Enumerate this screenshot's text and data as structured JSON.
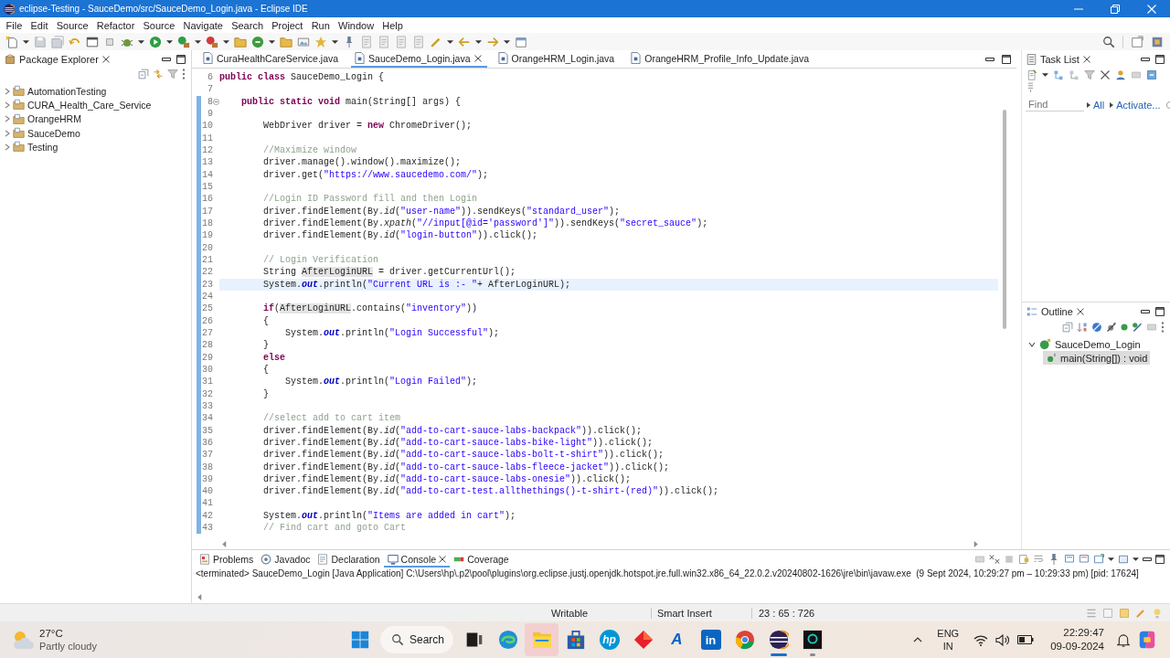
{
  "window": {
    "title": "eclipse-Testing - SauceDemo/src/SauceDemo_Login.java - Eclipse IDE"
  },
  "menu": [
    "File",
    "Edit",
    "Source",
    "Refactor",
    "Source",
    "Navigate",
    "Search",
    "Project",
    "Run",
    "Window",
    "Help"
  ],
  "package_explorer": {
    "title": "Package Explorer",
    "projects": [
      {
        "name": "AutomationTesting",
        "expanded": false
      },
      {
        "name": "CURA_Health_Care_Service",
        "expanded": false
      },
      {
        "name": "OrangeHRM",
        "expanded": false
      },
      {
        "name": "SauceDemo",
        "expanded": false
      },
      {
        "name": "Testing",
        "expanded": false
      }
    ]
  },
  "editor": {
    "tabs": [
      {
        "label": "CuraHealthCareService.java",
        "selected": false
      },
      {
        "label": "SauceDemo_Login.java",
        "selected": true
      },
      {
        "label": "OrangeHRM_Login.java",
        "selected": false
      },
      {
        "label": "OrangeHRM_Profile_Info_Update.java",
        "selected": false
      }
    ],
    "blocks": [
      {
        "kind": "plain",
        "lines": [
          {
            "number": "6",
            "current": false,
            "tokens": [
              {
                "kind": "keyword",
                "text": "public class"
              },
              {
                "kind": "plain",
                "text": " SauceDemo_Login {"
              }
            ]
          },
          {
            "number": "7",
            "current": false
          }
        ]
      },
      {
        "kind": "range",
        "lines": [
          {
            "number": "8",
            "current": false,
            "expanded": true,
            "tokens": [
              {
                "kind": "keyword",
                "text": "    public static void"
              },
              {
                "kind": "plain",
                "text": " main(String[] args) {"
              }
            ]
          },
          {
            "number": "9",
            "current": false
          },
          {
            "number": "10",
            "current": false,
            "tokens": [
              {
                "kind": "plain",
                "text": "        WebDriver driver = "
              },
              {
                "kind": "keyword",
                "text": "new"
              },
              {
                "kind": "plain",
                "text": " ChromeDriver();"
              }
            ]
          },
          {
            "number": "11",
            "current": false
          },
          {
            "number": "12",
            "current": false,
            "tokens": [
              {
                "kind": "comment",
                "text": "        //Maximize window"
              }
            ]
          },
          {
            "number": "13",
            "current": false,
            "tokens": [
              {
                "kind": "plain",
                "text": "        driver.manage().window().maximize();"
              }
            ]
          },
          {
            "number": "14",
            "current": false,
            "tokens": [
              {
                "kind": "plain",
                "text": "        driver.get("
              },
              {
                "kind": "string",
                "text": "\"https://www.saucedemo.com/\""
              },
              {
                "kind": "plain",
                "text": ");"
              }
            ]
          },
          {
            "number": "15",
            "current": false
          },
          {
            "number": "16",
            "current": false,
            "tokens": [
              {
                "kind": "comment",
                "text": "        //Login ID Password fill and then Login"
              }
            ]
          },
          {
            "number": "17",
            "current": false,
            "tokens": [
              {
                "kind": "plain",
                "text": "        driver.findElement(By."
              },
              {
                "kind": "static-method",
                "text": "id"
              },
              {
                "kind": "plain",
                "text": "("
              },
              {
                "kind": "string",
                "text": "\"user-name\""
              },
              {
                "kind": "plain",
                "text": ")).sendKeys("
              },
              {
                "kind": "string",
                "text": "\"standard_user\""
              },
              {
                "kind": "plain",
                "text": ");"
              }
            ]
          },
          {
            "number": "18",
            "current": false,
            "tokens": [
              {
                "kind": "plain",
                "text": "        driver.findElement(By."
              },
              {
                "kind": "static-method",
                "text": "xpath"
              },
              {
                "kind": "plain",
                "text": "("
              },
              {
                "kind": "string",
                "text": "\"//input[@id='password']\""
              },
              {
                "kind": "plain",
                "text": ")).sendKeys("
              },
              {
                "kind": "string",
                "text": "\"secret_sauce\""
              },
              {
                "kind": "plain",
                "text": ");"
              }
            ]
          },
          {
            "number": "19",
            "current": false,
            "tokens": [
              {
                "kind": "plain",
                "text": "        driver.findElement(By."
              },
              {
                "kind": "static-method",
                "text": "id"
              },
              {
                "kind": "plain",
                "text": "("
              },
              {
                "kind": "string",
                "text": "\"login-button\""
              },
              {
                "kind": "plain",
                "text": ")).click();"
              }
            ]
          },
          {
            "number": "20",
            "current": false
          },
          {
            "number": "21",
            "current": false,
            "tokens": [
              {
                "kind": "comment",
                "text": "        // Login Verification"
              }
            ]
          },
          {
            "number": "22",
            "current": false,
            "tokens": [
              {
                "kind": "plain",
                "text": "        String "
              },
              {
                "kind": "occurrence",
                "text": "AfterLoginURL"
              },
              {
                "kind": "plain",
                "text": " = driver.getCurrentUrl();"
              }
            ]
          },
          {
            "number": "23",
            "current": true,
            "tokens": [
              {
                "kind": "plain",
                "text": "        System."
              },
              {
                "kind": "static-field",
                "text": "out"
              },
              {
                "kind": "plain",
                "text": ".println("
              },
              {
                "kind": "string",
                "text": "\"Current URL is :- \""
              },
              {
                "kind": "plain",
                "text": "+ AfterLoginURL);"
              }
            ]
          },
          {
            "number": "24",
            "current": false
          },
          {
            "number": "25",
            "current": false,
            "tokens": [
              {
                "kind": "keyword",
                "text": "        if"
              },
              {
                "kind": "plain",
                "text": "("
              },
              {
                "kind": "occurrence",
                "text": "AfterLoginURL"
              },
              {
                "kind": "plain",
                "text": ".contains("
              },
              {
                "kind": "string",
                "text": "\"inventory\""
              },
              {
                "kind": "plain",
                "text": "))"
              }
            ]
          },
          {
            "number": "26",
            "current": false,
            "tokens": [
              {
                "kind": "plain",
                "text": "        {"
              }
            ]
          },
          {
            "number": "27",
            "current": false,
            "tokens": [
              {
                "kind": "plain",
                "text": "            System."
              },
              {
                "kind": "static-field",
                "text": "out"
              },
              {
                "kind": "plain",
                "text": ".println("
              },
              {
                "kind": "string",
                "text": "\"Login Successful\""
              },
              {
                "kind": "plain",
                "text": ");"
              }
            ]
          },
          {
            "number": "28",
            "current": false,
            "tokens": [
              {
                "kind": "plain",
                "text": "        }"
              }
            ]
          },
          {
            "number": "29",
            "current": false,
            "tokens": [
              {
                "kind": "keyword",
                "text": "        else"
              }
            ]
          },
          {
            "number": "30",
            "current": false,
            "tokens": [
              {
                "kind": "plain",
                "text": "        {"
              }
            ]
          },
          {
            "number": "31",
            "current": false,
            "tokens": [
              {
                "kind": "plain",
                "text": "            System."
              },
              {
                "kind": "static-field",
                "text": "out"
              },
              {
                "kind": "plain",
                "text": ".println("
              },
              {
                "kind": "string",
                "text": "\"Login Failed\""
              },
              {
                "kind": "plain",
                "text": ");"
              }
            ]
          },
          {
            "number": "32",
            "current": false,
            "tokens": [
              {
                "kind": "plain",
                "text": "        }"
              }
            ]
          },
          {
            "number": "33",
            "current": false
          },
          {
            "number": "34",
            "current": false,
            "tokens": [
              {
                "kind": "comment",
                "text": "        //select add to cart item"
              }
            ]
          },
          {
            "number": "35",
            "current": false,
            "tokens": [
              {
                "kind": "plain",
                "text": "        driver.findElement(By."
              },
              {
                "kind": "static-method",
                "text": "id"
              },
              {
                "kind": "plain",
                "text": "("
              },
              {
                "kind": "string",
                "text": "\"add-to-cart-sauce-labs-backpack\""
              },
              {
                "kind": "plain",
                "text": ")).click();"
              }
            ]
          },
          {
            "number": "36",
            "current": false,
            "tokens": [
              {
                "kind": "plain",
                "text": "        driver.findElement(By."
              },
              {
                "kind": "static-method",
                "text": "id"
              },
              {
                "kind": "plain",
                "text": "("
              },
              {
                "kind": "string",
                "text": "\"add-to-cart-sauce-labs-bike-light\""
              },
              {
                "kind": "plain",
                "text": ")).click();"
              }
            ]
          },
          {
            "number": "37",
            "current": false,
            "tokens": [
              {
                "kind": "plain",
                "text": "        driver.findElement(By."
              },
              {
                "kind": "static-method",
                "text": "id"
              },
              {
                "kind": "plain",
                "text": "("
              },
              {
                "kind": "string",
                "text": "\"add-to-cart-sauce-labs-bolt-t-shirt\""
              },
              {
                "kind": "plain",
                "text": ")).click();"
              }
            ]
          },
          {
            "number": "38",
            "current": false,
            "tokens": [
              {
                "kind": "plain",
                "text": "        driver.findElement(By."
              },
              {
                "kind": "static-method",
                "text": "id"
              },
              {
                "kind": "plain",
                "text": "("
              },
              {
                "kind": "string",
                "text": "\"add-to-cart-sauce-labs-fleece-jacket\""
              },
              {
                "kind": "plain",
                "text": ")).click();"
              }
            ]
          },
          {
            "number": "39",
            "current": false,
            "tokens": [
              {
                "kind": "plain",
                "text": "        driver.findElement(By."
              },
              {
                "kind": "static-method",
                "text": "id"
              },
              {
                "kind": "plain",
                "text": "("
              },
              {
                "kind": "string",
                "text": "\"add-to-cart-sauce-labs-onesie\""
              },
              {
                "kind": "plain",
                "text": ")).click();"
              }
            ]
          },
          {
            "number": "40",
            "current": false,
            "tokens": [
              {
                "kind": "plain",
                "text": "        driver.findElement(By."
              },
              {
                "kind": "static-method",
                "text": "id"
              },
              {
                "kind": "plain",
                "text": "("
              },
              {
                "kind": "string",
                "text": "\"add-to-cart-test.allthethings()-t-shirt-(red)\""
              },
              {
                "kind": "plain",
                "text": ")).click();"
              }
            ]
          },
          {
            "number": "41",
            "current": false
          },
          {
            "number": "42",
            "current": false,
            "tokens": [
              {
                "kind": "plain",
                "text": "        System."
              },
              {
                "kind": "static-field",
                "text": "out"
              },
              {
                "kind": "plain",
                "text": ".println("
              },
              {
                "kind": "string",
                "text": "\"Items are added in cart\""
              },
              {
                "kind": "plain",
                "text": ");"
              }
            ]
          },
          {
            "number": "43",
            "current": false,
            "tokens": [
              {
                "kind": "comment",
                "text": "        // Find cart and goto Cart"
              }
            ]
          }
        ]
      }
    ]
  },
  "task_list": {
    "title": "Task List",
    "find": {
      "placeholder": "Find"
    },
    "links": [
      "All",
      "Activate..."
    ]
  },
  "outline": {
    "title": "Outline",
    "items": [
      {
        "name": "SauceDemo_Login",
        "kind": "class",
        "expanded": true,
        "selected": false,
        "children": [
          {
            "name": "main(String[]) : void",
            "kind": "method",
            "selected": true
          }
        ]
      }
    ]
  },
  "console": {
    "tabs": [
      {
        "label": "Problems",
        "kind": "problems",
        "selected": false
      },
      {
        "label": "Javadoc",
        "kind": "javadoc",
        "selected": false
      },
      {
        "label": "Declaration",
        "kind": "declaration",
        "selected": false
      },
      {
        "label": "Console",
        "kind": "console",
        "selected": true
      },
      {
        "label": "Coverage",
        "kind": "coverage",
        "selected": false
      }
    ],
    "output": "<terminated> SauceDemo_Login [Java Application] C:\\Users\\hp\\.p2\\pool\\plugins\\org.eclipse.justj.openjdk.hotspot.jre.full.win32.x86_64_22.0.2.v20240802-1626\\jre\\bin\\javaw.exe  (9 Sept 2024, 10:29:27 pm – 10:29:33 pm) [pid: 17624]"
  },
  "status_bar": {
    "mode": "Writable",
    "insert_mode": "Smart Insert",
    "position": "23 : 65 : 726"
  },
  "taskbar": {
    "weather": {
      "temperature": "27°C",
      "condition": "Partly cloudy"
    },
    "apps": [
      {
        "kind": "start",
        "running": false,
        "active": false,
        "highlighted": false
      },
      {
        "kind": "search",
        "label": "Search",
        "running": false,
        "active": false,
        "highlighted": false
      },
      {
        "kind": "taskview",
        "running": false,
        "active": false,
        "highlighted": false
      },
      {
        "kind": "edge",
        "running": false,
        "active": false,
        "highlighted": false
      },
      {
        "kind": "explorer",
        "running": false,
        "active": false,
        "highlighted": true
      },
      {
        "kind": "store",
        "running": false,
        "active": false,
        "highlighted": false
      },
      {
        "kind": "hp",
        "glyph": "hp",
        "running": false,
        "active": false,
        "highlighted": false
      },
      {
        "kind": "diamond",
        "running": false,
        "active": false,
        "highlighted": false
      },
      {
        "kind": "azure",
        "glyph": "A",
        "running": false,
        "active": false,
        "highlighted": false
      },
      {
        "kind": "linkedin",
        "glyph": "in",
        "running": false,
        "active": false,
        "highlighted": false
      },
      {
        "kind": "chrome",
        "running": false,
        "active": false,
        "highlighted": false
      },
      {
        "kind": "eclipse",
        "running": true,
        "active": true,
        "highlighted": false
      },
      {
        "kind": "terminal",
        "running": true,
        "active": false,
        "highlighted": false
      }
    ],
    "tray": {
      "language": "ENG",
      "region": "IN",
      "time": "22:29:47",
      "date": "09-09-2024"
    }
  }
}
